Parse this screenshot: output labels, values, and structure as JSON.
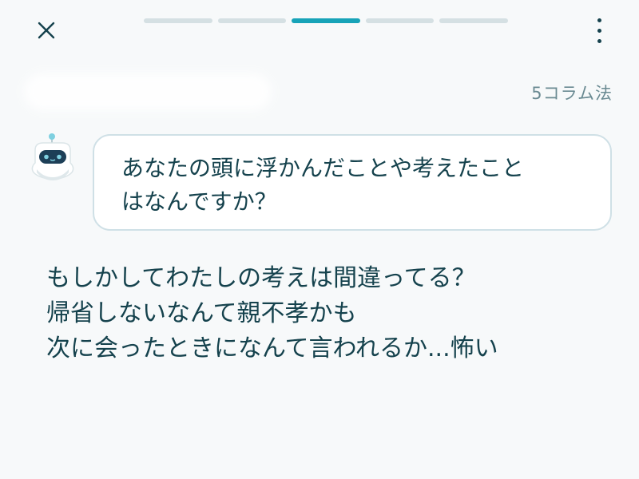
{
  "topbar": {
    "close_icon": "close-icon",
    "progress": {
      "total_steps": 5,
      "current_step": 3
    },
    "menu_icon": "more-vertical-icon"
  },
  "header": {
    "method_label": "5コラム法"
  },
  "prompt": {
    "avatar_icon": "robot-avatar-icon",
    "question": "あなたの頭に浮かんだことや考えたこと\nはなんですか？"
  },
  "answer": {
    "lines": [
      "もしかしてわたしの考えは間違ってる？",
      "帰省しないなんて親不孝かも",
      "次に会ったときになんて言われるか...怖い"
    ]
  },
  "colors": {
    "accent": "#17a3b8",
    "text": "#15424d",
    "muted": "#6a8a92",
    "bubble_border": "#cfe0e6",
    "background": "#f7f9fa"
  }
}
